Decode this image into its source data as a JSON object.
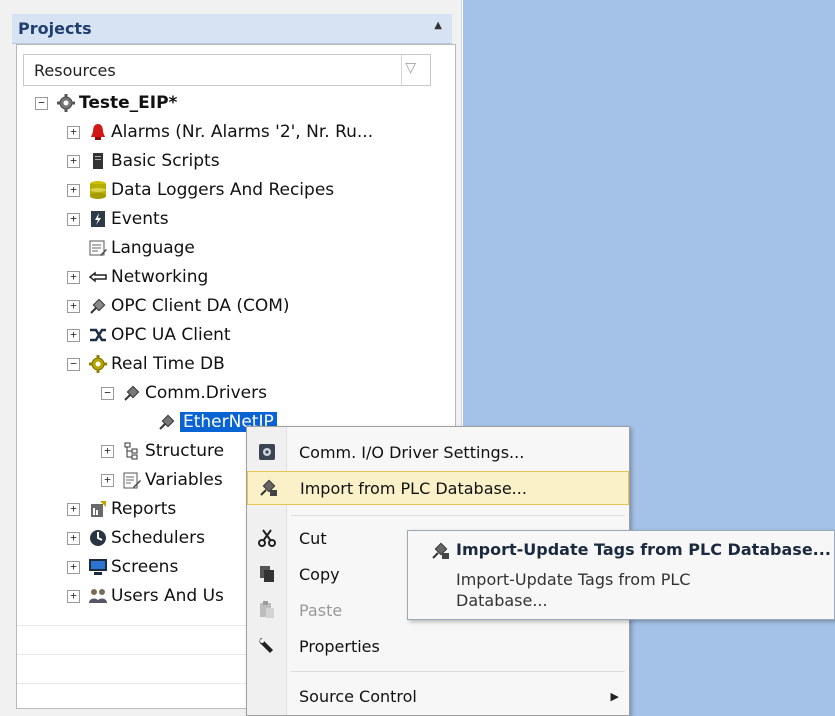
{
  "pane": {
    "title": "Projects",
    "column_header": "Resources"
  },
  "tree": {
    "root": "Teste_EIP*",
    "items": [
      {
        "label": "Alarms (Nr. Alarms '2', Nr. Ru...",
        "icon": "bell-icon"
      },
      {
        "label": "Basic Scripts",
        "icon": "script-icon"
      },
      {
        "label": "Data Loggers And Recipes",
        "icon": "database-icon"
      },
      {
        "label": "Events",
        "icon": "events-icon"
      },
      {
        "label": "Language",
        "icon": "language-icon"
      },
      {
        "label": "Networking",
        "icon": "networking-icon"
      },
      {
        "label": "OPC Client DA (COM)",
        "icon": "opc-da-icon"
      },
      {
        "label": "OPC UA Client",
        "icon": "opc-ua-icon"
      },
      {
        "label": "Real Time DB",
        "icon": "gear-icon"
      },
      {
        "label": "Comm.Drivers",
        "icon": "plug-icon"
      },
      {
        "label": "EtherNetIP",
        "icon": "plug-icon"
      },
      {
        "label": "Structure",
        "icon": "structure-icon"
      },
      {
        "label": "Variables",
        "icon": "variables-icon"
      },
      {
        "label": "Reports",
        "icon": "reports-icon"
      },
      {
        "label": "Schedulers",
        "icon": "clock-icon"
      },
      {
        "label": "Screens",
        "icon": "monitor-icon"
      },
      {
        "label": "Users And Us",
        "icon": "users-icon"
      }
    ]
  },
  "context_menu": {
    "items": [
      {
        "label": "Comm. I/O Driver Settings...",
        "icon": "driver-settings-icon"
      },
      {
        "label": "Import from PLC Database...",
        "icon": "import-icon"
      },
      {
        "label": "Cut",
        "icon": "scissors-icon"
      },
      {
        "label": "Copy",
        "icon": "copy-icon"
      },
      {
        "label": "Paste",
        "icon": "paste-icon"
      },
      {
        "label": "Properties",
        "icon": "wrench-icon"
      },
      {
        "label": "Source Control",
        "icon": ""
      }
    ]
  },
  "submenu": {
    "title": "Import-Update Tags from PLC Database...",
    "description": "Import-Update Tags from PLC Database..."
  },
  "colors": {
    "accent": "#0a63d2",
    "background": "#a4c2e7",
    "hover": "#fbf1c8"
  }
}
